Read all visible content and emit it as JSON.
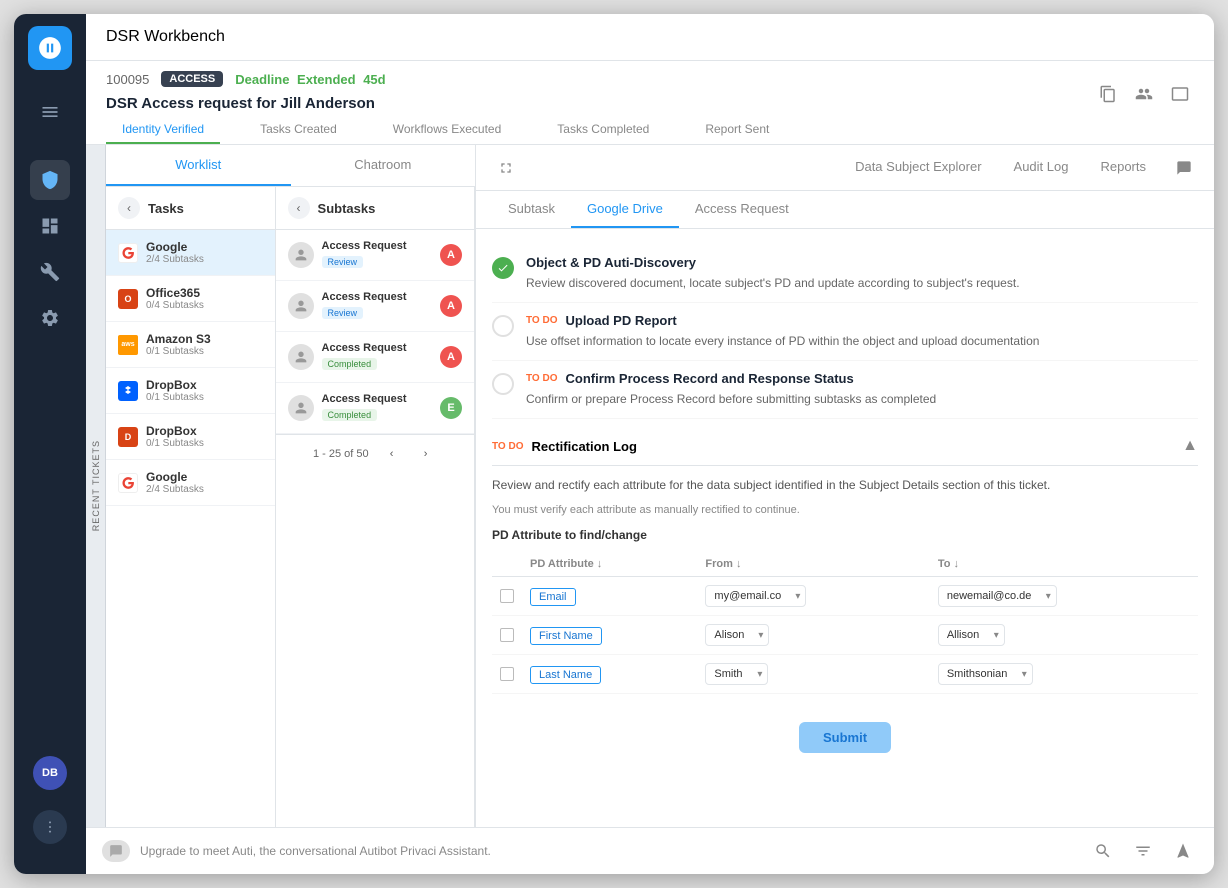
{
  "app": {
    "title": "DSR Workbench",
    "logo_initials": "s"
  },
  "sidebar": {
    "menu_icon": "☰",
    "items": [
      {
        "id": "home",
        "icon": "⊙",
        "active": false
      },
      {
        "id": "dashboard",
        "icon": "▦",
        "active": false
      },
      {
        "id": "tools",
        "icon": "⚙",
        "active": false
      },
      {
        "id": "settings",
        "icon": "⚙",
        "active": false
      }
    ],
    "avatar": "DB",
    "dots": "⠿"
  },
  "ticket": {
    "title": "DSR Access request for Jill Anderson",
    "id": "100095",
    "badge": "ACCESS",
    "deadline_label": "Deadline",
    "deadline_status": "Extended",
    "deadline_days": "45d",
    "tabs": [
      {
        "label": "Identity Verified",
        "active": true
      },
      {
        "label": "Tasks Created",
        "active": false
      },
      {
        "label": "Workflows Executed",
        "active": false
      },
      {
        "label": "Tasks Completed",
        "active": false
      },
      {
        "label": "Report Sent",
        "active": false
      }
    ]
  },
  "main_tabs": [
    {
      "label": "Worklist",
      "active": true
    },
    {
      "label": "Chatroom",
      "active": false
    },
    {
      "label": "Data Subject Explorer",
      "active": false
    },
    {
      "label": "Audit Log",
      "active": false
    },
    {
      "label": "Reports",
      "active": false
    }
  ],
  "tasks": {
    "header": "Tasks",
    "items": [
      {
        "name": "Google",
        "sub": "2/4 Subtasks",
        "logo_color": "#ea4335",
        "logo_text": "G",
        "active": true
      },
      {
        "name": "Office365",
        "sub": "0/4 Subtasks",
        "logo_color": "#d84315",
        "logo_text": "O"
      },
      {
        "name": "Amazon S3",
        "sub": "0/1 Subtasks",
        "logo_color": "#ff9800",
        "logo_text": "aws"
      },
      {
        "name": "DropBox",
        "sub": "0/1 Subtasks",
        "logo_color": "#0061fe",
        "logo_text": "D"
      },
      {
        "name": "DropBox",
        "sub": "0/1 Subtasks",
        "logo_color": "#d84315",
        "logo_text": "D"
      },
      {
        "name": "Google",
        "sub": "2/4 Subtasks",
        "logo_color": "#ea4335",
        "logo_text": "G"
      }
    ]
  },
  "subtasks": {
    "header": "Subtasks",
    "items": [
      {
        "name": "Access Request",
        "badge": "Review",
        "badge_type": "review",
        "letter": "A",
        "letter_color": "#ef5350"
      },
      {
        "name": "Access Request",
        "badge": "Review",
        "badge_type": "review",
        "letter": "A",
        "letter_color": "#ef5350"
      },
      {
        "name": "Access Request",
        "badge": "Completed",
        "badge_type": "completed",
        "letter": "A",
        "letter_color": "#ef5350"
      },
      {
        "name": "Access Request",
        "badge": "Completed",
        "badge_type": "completed",
        "letter": "E",
        "letter_color": "#66bb6a"
      }
    ],
    "pagination": "1 - 25 of 50"
  },
  "detail": {
    "tabs": [
      {
        "label": "Subtask",
        "active": false
      },
      {
        "label": "Google Drive",
        "active": true
      },
      {
        "label": "Access Request",
        "active": false
      }
    ],
    "tasks": [
      {
        "id": "task1",
        "status": "done",
        "title": "Object & PD Auti-Discovery",
        "description": "Review discovered document, locate subject's PD and update according to subject's request."
      },
      {
        "id": "task2",
        "status": "todo",
        "todo_label": "TO DO",
        "title": "Upload PD Report",
        "description": "Use offset information to locate every instance of PD within the object and upload documentation"
      },
      {
        "id": "task3",
        "status": "todo",
        "todo_label": "TO DO",
        "title": "Confirm Process Record and Response Status",
        "description": "Confirm or prepare Process Record before submitting subtasks as completed"
      }
    ],
    "rectification": {
      "todo_label": "TO DO",
      "title": "Rectification Log",
      "description": "Review and rectify each attribute for the data subject identified in the Subject Details section of this ticket.",
      "note": "You must verify each attribute as manually rectified to continue.",
      "attr_section_title": "PD Attribute to find/change",
      "table_headers": [
        "",
        "PD Attribute ↓",
        "From ↓",
        "To ↓"
      ],
      "rows": [
        {
          "id": "row_header",
          "is_header": true
        },
        {
          "id": "row_email",
          "attr": "Email",
          "from": "my@email.co",
          "to": "newemail@co.de"
        },
        {
          "id": "row_firstname",
          "attr": "First Name",
          "from": "Alison",
          "to": "Allison"
        },
        {
          "id": "row_lastname",
          "attr": "Last Name",
          "from": "Smith",
          "to": "Smithsonian"
        }
      ],
      "submit_label": "Submit"
    }
  },
  "recent_tickets_label": "RECENT TICKETS",
  "bottom_bar": {
    "message": "Upgrade to meet Auti, the conversational Autibot Privaci Assistant."
  }
}
